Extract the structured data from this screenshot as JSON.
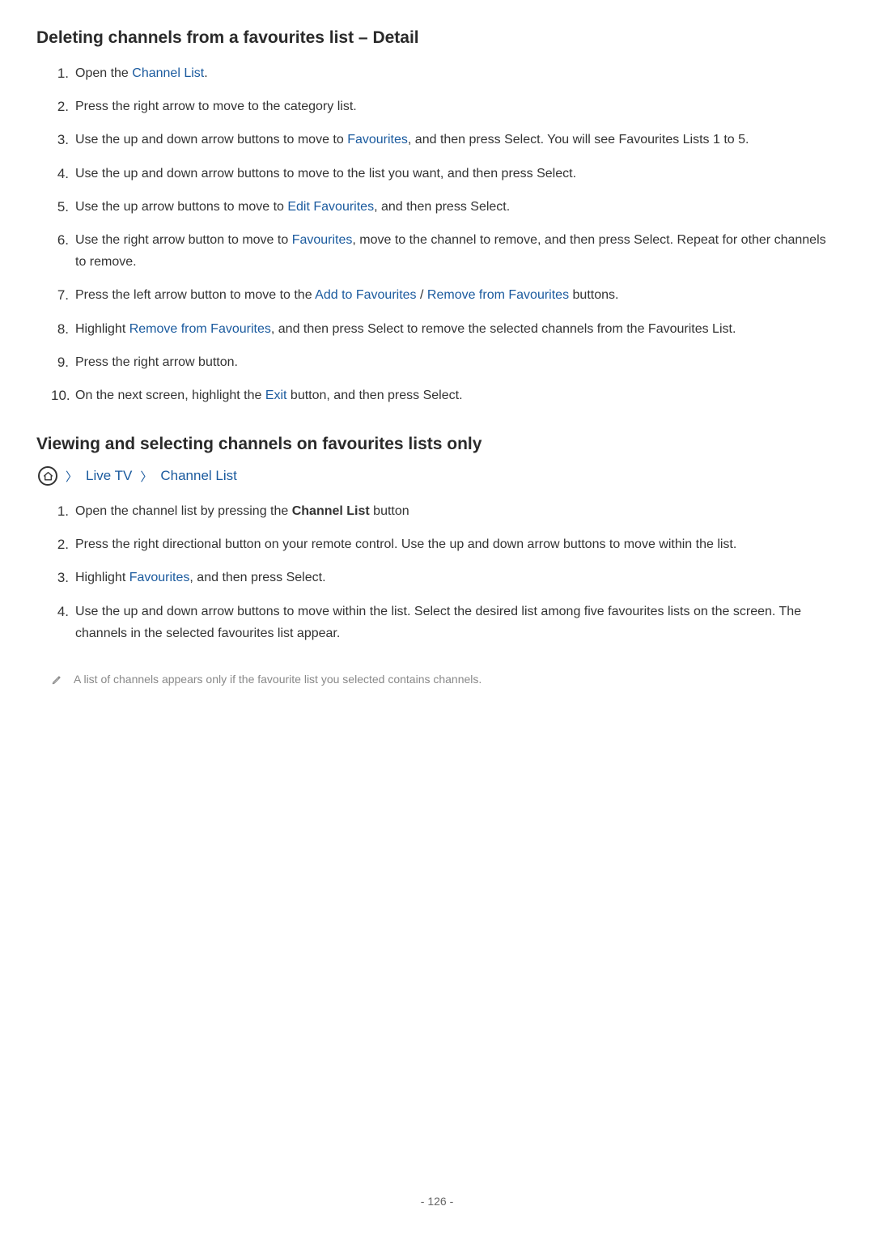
{
  "section1": {
    "heading": "Deleting channels from a favourites list – Detail",
    "steps": [
      {
        "num": "1.",
        "parts": [
          {
            "text": "Open the ",
            "bold": false,
            "link": false
          },
          {
            "text": "Channel List",
            "bold": false,
            "link": true
          },
          {
            "text": ".",
            "bold": false,
            "link": false
          }
        ]
      },
      {
        "num": "2.",
        "parts": [
          {
            "text": "Press the right arrow to move to the category list.",
            "bold": false,
            "link": false
          }
        ]
      },
      {
        "num": "3.",
        "parts": [
          {
            "text": "Use the up and down arrow buttons to move to ",
            "bold": false,
            "link": false
          },
          {
            "text": "Favourites",
            "bold": false,
            "link": true
          },
          {
            "text": ", and then press Select. You will see Favourites Lists 1 to 5.",
            "bold": false,
            "link": false
          }
        ]
      },
      {
        "num": "4.",
        "parts": [
          {
            "text": "Use the up and down arrow buttons to move to the list you want, and then press Select.",
            "bold": false,
            "link": false
          }
        ]
      },
      {
        "num": "5.",
        "parts": [
          {
            "text": "Use the up arrow buttons to move to ",
            "bold": false,
            "link": false
          },
          {
            "text": "Edit Favourites",
            "bold": false,
            "link": true
          },
          {
            "text": ", and then press Select.",
            "bold": false,
            "link": false
          }
        ]
      },
      {
        "num": "6.",
        "parts": [
          {
            "text": "Use the right arrow button to move to ",
            "bold": false,
            "link": false
          },
          {
            "text": "Favourites",
            "bold": false,
            "link": true
          },
          {
            "text": ", move to the channel to remove, and then press Select. Repeat for other channels to remove.",
            "bold": false,
            "link": false
          }
        ]
      },
      {
        "num": "7.",
        "parts": [
          {
            "text": "Press the left arrow button to move to the ",
            "bold": false,
            "link": false
          },
          {
            "text": "Add to Favourites",
            "bold": false,
            "link": true
          },
          {
            "text": " / ",
            "bold": false,
            "link": false
          },
          {
            "text": "Remove from Favourites",
            "bold": false,
            "link": true
          },
          {
            "text": " buttons.",
            "bold": false,
            "link": false
          }
        ]
      },
      {
        "num": "8.",
        "parts": [
          {
            "text": "Highlight ",
            "bold": false,
            "link": false
          },
          {
            "text": "Remove from Favourites",
            "bold": false,
            "link": true
          },
          {
            "text": ", and then press Select to remove the selected channels from the Favourites List.",
            "bold": false,
            "link": false
          }
        ]
      },
      {
        "num": "9.",
        "parts": [
          {
            "text": "Press the right arrow button.",
            "bold": false,
            "link": false
          }
        ]
      },
      {
        "num": "10.",
        "parts": [
          {
            "text": "On the next screen, highlight the ",
            "bold": false,
            "link": false
          },
          {
            "text": "Exit",
            "bold": false,
            "link": true
          },
          {
            "text": " button, and then press Select.",
            "bold": false,
            "link": false
          }
        ]
      }
    ]
  },
  "section2": {
    "heading": "Viewing and selecting channels on favourites lists only",
    "breadcrumb": {
      "item1": "Live TV",
      "item2": "Channel List"
    },
    "steps": [
      {
        "num": "1.",
        "parts": [
          {
            "text": "Open the channel list by pressing the ",
            "bold": false,
            "link": false
          },
          {
            "text": "Channel List",
            "bold": true,
            "link": false
          },
          {
            "text": " button",
            "bold": false,
            "link": false
          }
        ]
      },
      {
        "num": "2.",
        "parts": [
          {
            "text": "Press the right directional button on your remote control. Use the up and down arrow buttons to move within the list.",
            "bold": false,
            "link": false
          }
        ]
      },
      {
        "num": "3.",
        "parts": [
          {
            "text": "Highlight ",
            "bold": false,
            "link": false
          },
          {
            "text": "Favourites",
            "bold": false,
            "link": true
          },
          {
            "text": ", and then press Select.",
            "bold": false,
            "link": false
          }
        ]
      },
      {
        "num": "4.",
        "parts": [
          {
            "text": "Use the up and down arrow buttons to move within the list. Select the desired list among five favourites lists on the screen. The channels in the selected favourites list appear.",
            "bold": false,
            "link": false
          }
        ]
      }
    ],
    "note": "A list of channels appears only if the favourite list you selected contains channels."
  },
  "pageNumber": "- 126 -"
}
